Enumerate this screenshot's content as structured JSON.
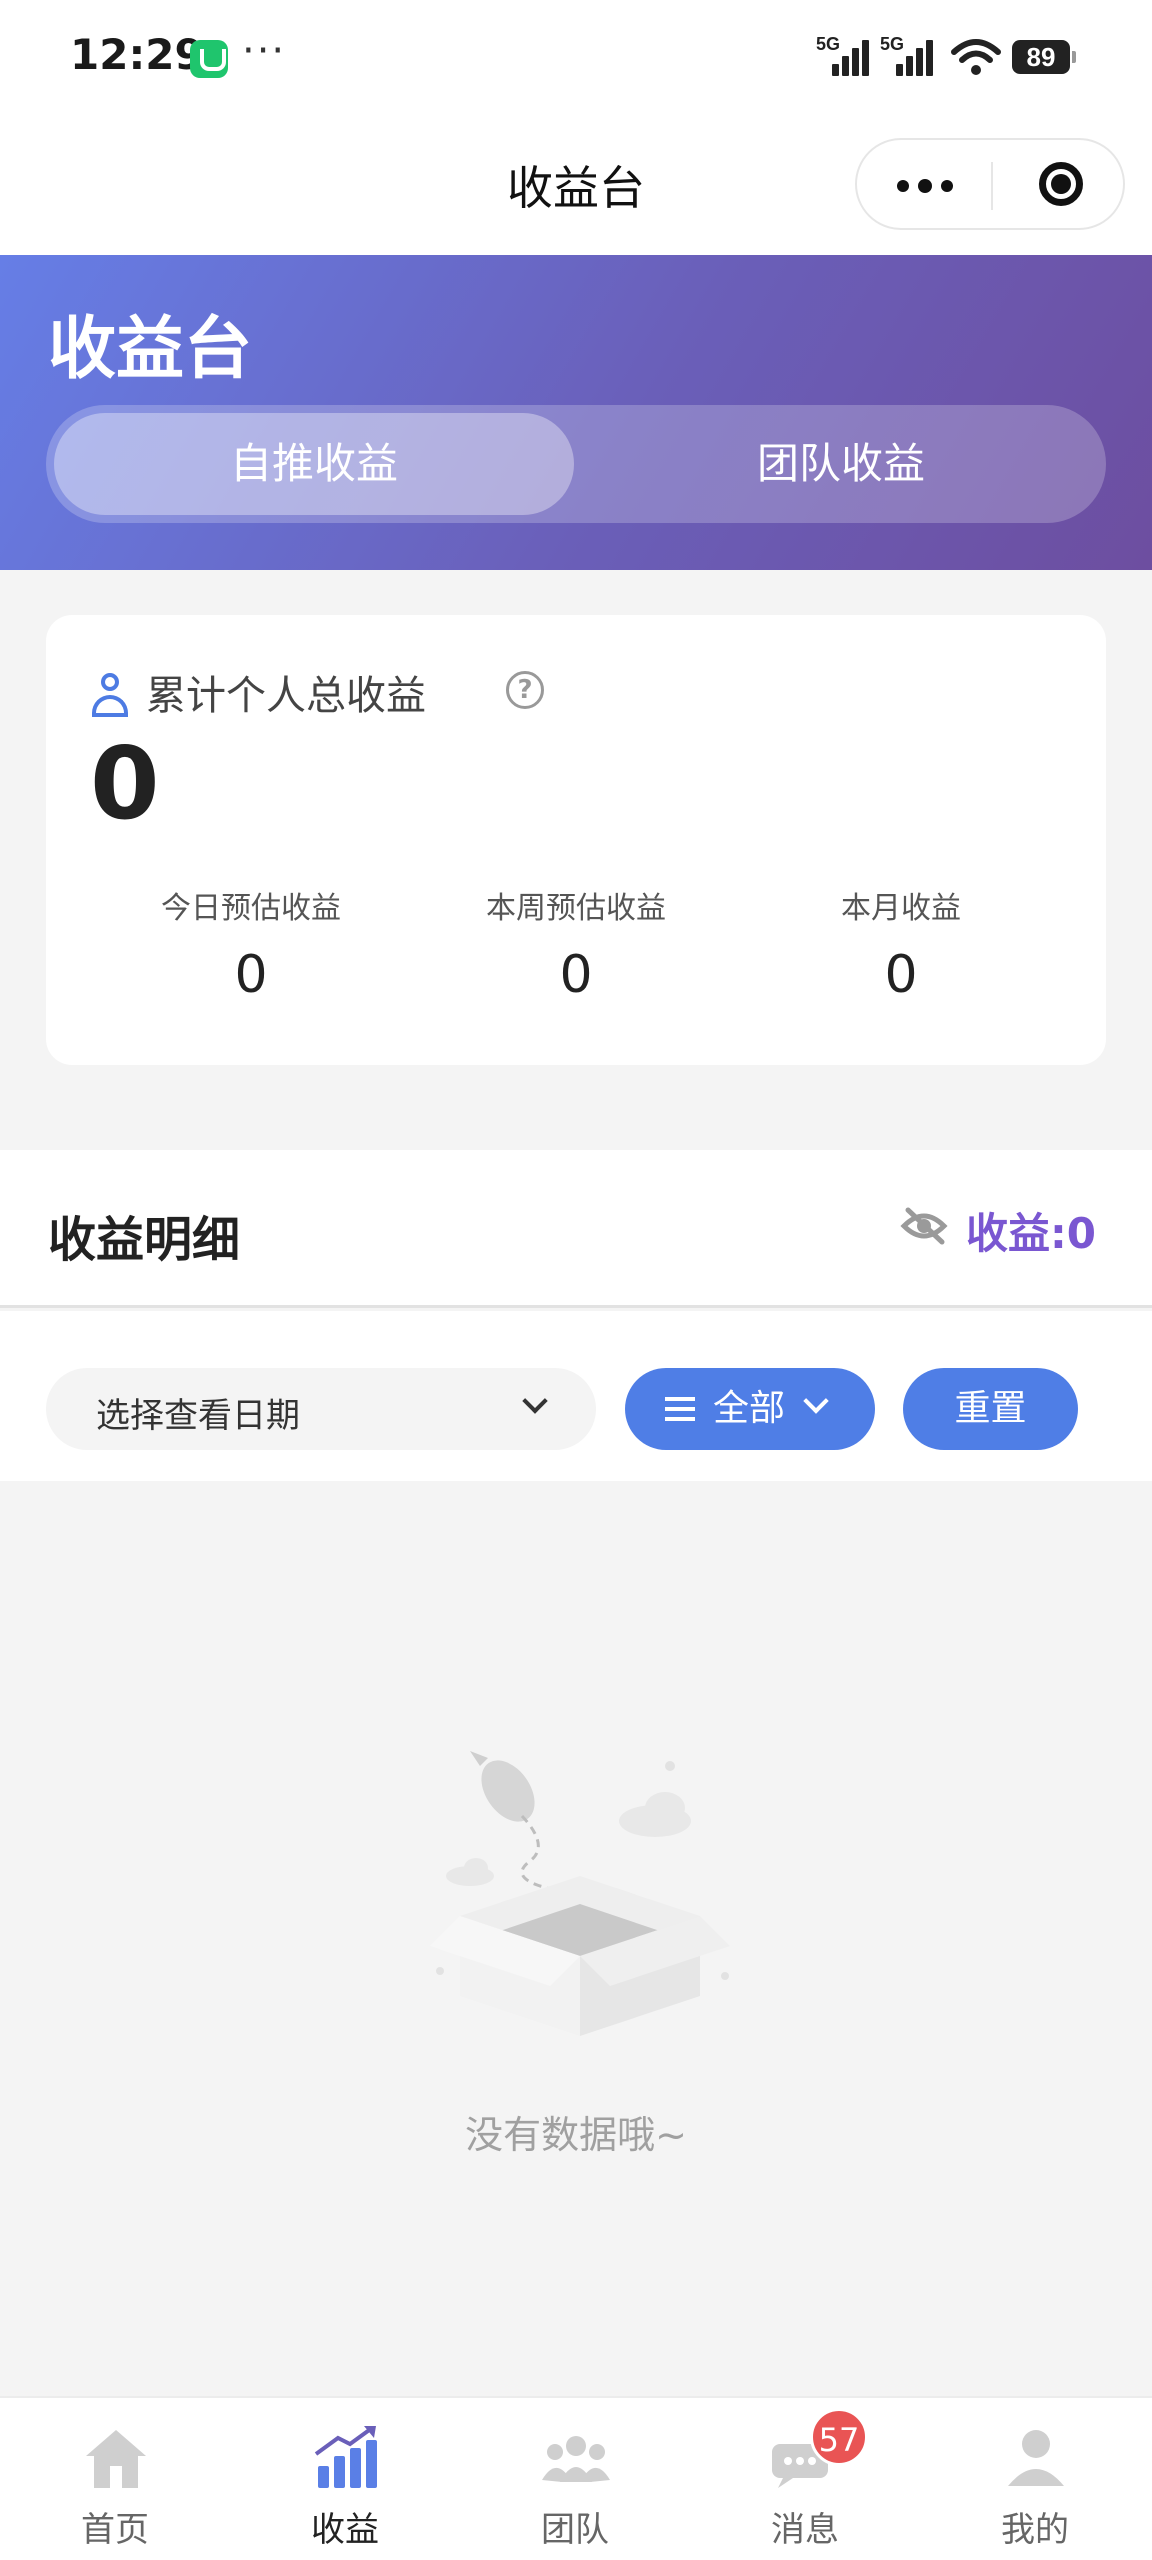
{
  "status_bar": {
    "time": "12:29",
    "signal1_label": "5G",
    "signal2_label": "5G",
    "battery": "89"
  },
  "nav": {
    "title": "收益台"
  },
  "hero": {
    "title": "收益台",
    "tabs": [
      {
        "label": "自推收益",
        "active": true
      },
      {
        "label": "团队收益",
        "active": false
      }
    ]
  },
  "summary": {
    "label": "累计个人总收益",
    "help_icon": "?",
    "total": "0",
    "stats": [
      {
        "label": "今日预估收益",
        "value": "0"
      },
      {
        "label": "本周预估收益",
        "value": "0"
      },
      {
        "label": "本月收益",
        "value": "0"
      }
    ]
  },
  "detail": {
    "title": "收益明细",
    "income_label": "收益:0"
  },
  "filter": {
    "date_placeholder": "选择查看日期",
    "category_label": "全部",
    "reset_label": "重置"
  },
  "empty": {
    "text": "没有数据哦~"
  },
  "tabbar": {
    "items": [
      {
        "label": "首页",
        "icon": "home-icon"
      },
      {
        "label": "收益",
        "icon": "chart-icon",
        "active": true
      },
      {
        "label": "团队",
        "icon": "team-icon"
      },
      {
        "label": "消息",
        "icon": "message-icon",
        "badge": "57"
      },
      {
        "label": "我的",
        "icon": "profile-icon"
      }
    ]
  },
  "colors": {
    "accent_blue": "#4f7ee6",
    "accent_purple": "#7a57d1",
    "hero_gradient_start": "#667ee6",
    "hero_gradient_end": "#6d4ea0",
    "badge_red": "#e95454"
  }
}
